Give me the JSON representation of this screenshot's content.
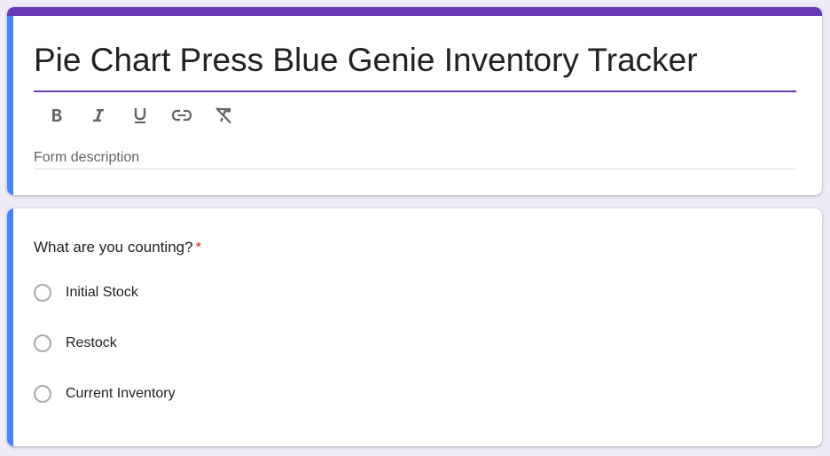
{
  "form": {
    "title": "Pie Chart Press Blue Genie Inventory Tracker",
    "description_placeholder": "Form description",
    "toolbar": [
      {
        "name": "bold",
        "icon": "bold-icon"
      },
      {
        "name": "italic",
        "icon": "italic-icon"
      },
      {
        "name": "underline",
        "icon": "underline-icon"
      },
      {
        "name": "link",
        "icon": "link-icon"
      },
      {
        "name": "clear-format",
        "icon": "clear-format-icon"
      }
    ]
  },
  "question": {
    "text": "What are you counting?",
    "required_marker": "*",
    "options": [
      {
        "label": "Initial Stock"
      },
      {
        "label": "Restock"
      },
      {
        "label": "Current Inventory"
      }
    ]
  },
  "colors": {
    "accent": "#673ab7",
    "left_bar": "#4285f4",
    "required": "#d93025",
    "background": "#efebf8"
  }
}
